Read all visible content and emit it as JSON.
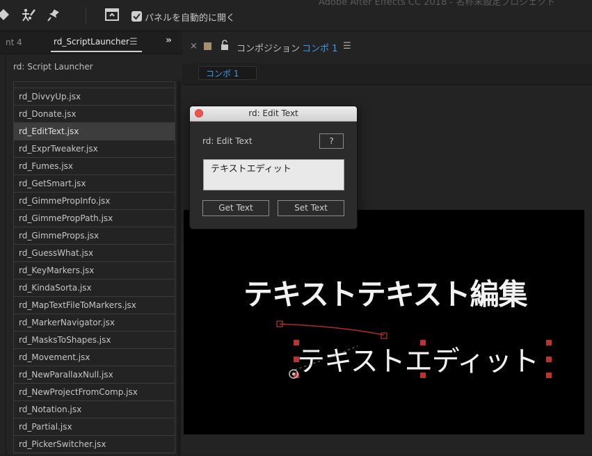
{
  "app": {
    "title": "Adobe After Effects CC 2018 - 名称未設定プロジェクト"
  },
  "toolbar": {
    "auto_open_label": "パネルを自動的に開く",
    "auto_open_checked": true
  },
  "left_panel": {
    "partial_tab": "nt 4",
    "active_tab": "rd_ScriptLauncher",
    "title": "rd: Script Launcher",
    "scripts": [
      {
        "label": "rd_DivvyUp.jsx"
      },
      {
        "label": "rd_Donate.jsx"
      },
      {
        "label": "rd_EditText.jsx",
        "selected": true
      },
      {
        "label": "rd_ExprTweaker.jsx"
      },
      {
        "label": "rd_Fumes.jsx"
      },
      {
        "label": "rd_GetSmart.jsx"
      },
      {
        "label": "rd_GimmePropInfo.jsx"
      },
      {
        "label": "rd_GimmePropPath.jsx"
      },
      {
        "label": "rd_GimmeProps.jsx"
      },
      {
        "label": "rd_GuessWhat.jsx"
      },
      {
        "label": "rd_KeyMarkers.jsx"
      },
      {
        "label": "rd_KindaSorta.jsx"
      },
      {
        "label": "rd_MapTextFileToMarkers.jsx"
      },
      {
        "label": "rd_MarkerNavigator.jsx"
      },
      {
        "label": "rd_MasksToShapes.jsx"
      },
      {
        "label": "rd_Movement.jsx"
      },
      {
        "label": "rd_NewParallaxNull.jsx"
      },
      {
        "label": "rd_NewProjectFromComp.jsx"
      },
      {
        "label": "rd_Notation.jsx"
      },
      {
        "label": "rd_Partial.jsx"
      },
      {
        "label": "rd_PickerSwitcher.jsx"
      }
    ]
  },
  "composition": {
    "title_prefix": "コンポジション",
    "name": "コンポ 1",
    "subtab": "コンポ 1",
    "swatch_color": "#a58f6c",
    "canvas_title": "テキストテキスト編集",
    "canvas_text": "テキストエディット"
  },
  "dialog": {
    "title": "rd: Edit Text",
    "label": "rd: Edit Text",
    "help_label": "?",
    "text_value": "テキストエディット",
    "get_text_label": "Get Text",
    "set_text_label": "Set Text"
  },
  "colors": {
    "accent_blue": "#3a9bea",
    "selection_handles": "#c0312f"
  }
}
